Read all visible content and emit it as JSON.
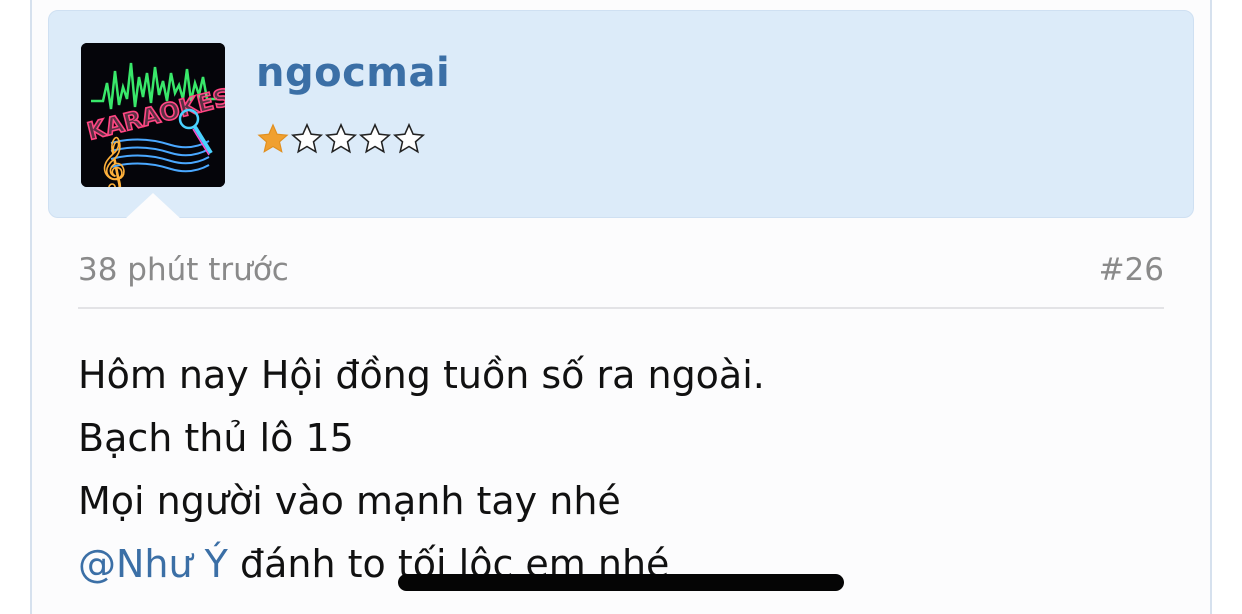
{
  "post": {
    "username": "ngocmai",
    "rating": 1,
    "rating_max": 5,
    "timestamp": "38 phút trước",
    "post_number": "#26",
    "avatar_text": "KARAOKES",
    "message": {
      "line1": "Hôm nay Hội đồng tuồn số ra ngoài.",
      "line2": "Bạch thủ lô 15",
      "line3": "Mọi người vào mạnh tay nhé",
      "line4_mention": "@Như Ý",
      "line4_rest": " đánh to tối lộc em nhé"
    }
  },
  "colors": {
    "header_bg": "#dcebf9",
    "username": "#3b6fa6",
    "mention": "#3b6fa6",
    "star_filled": "#f0a030",
    "meta_text": "#8a8a8a"
  }
}
